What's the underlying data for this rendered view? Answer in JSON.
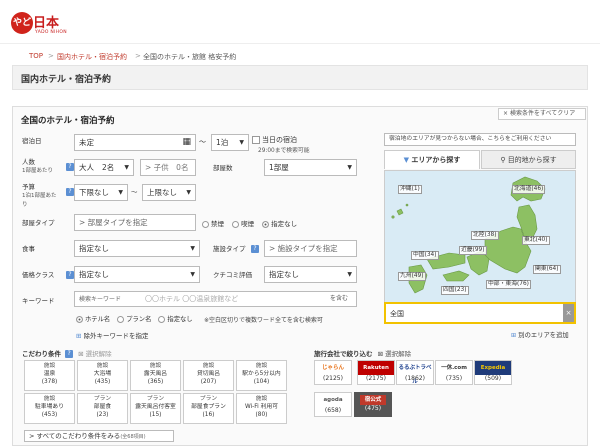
{
  "brand": {
    "logo_mark": "やど",
    "name": "日本",
    "sub": "YADO NIHON",
    "color": "#d0231b"
  },
  "breadcrumb": [
    "TOP",
    "国内ホテル・宿泊予約",
    "全国のホテル・旅館 格安予約"
  ],
  "page_title": "国内ホテル・宿泊予約",
  "clear_all": "検索条件をすべてクリア",
  "search": {
    "title": "全国のホテル・宿泊予約",
    "checkin_label": "宿泊日",
    "checkin_value": "未定",
    "nights_value": "1泊",
    "sameday_label": "当日の宿泊",
    "sameday_note": "29:00まで検索可能",
    "people_label": "人数",
    "people_sub": "1部屋あたり",
    "adults_label": "大人",
    "adults_value": "2名",
    "children_value": "子供　0名",
    "rooms_label": "部屋数",
    "rooms_value": "1部屋",
    "budget_label": "予算",
    "budget_sub1": "1泊1部屋あた",
    "budget_sub2": "り",
    "budget_min": "下限なし",
    "budget_max": "上限なし",
    "roomtype_label": "部屋タイプ",
    "roomtype_placeholder": "部屋タイプを指定",
    "smoke_options": [
      "禁煙",
      "喫煙",
      "指定なし"
    ],
    "meal_label": "食事",
    "meal_value": "指定なし",
    "facility_label": "施設タイプ",
    "facility_placeholder": "施設タイプを指定",
    "price_label": "価格クラス",
    "price_value": "指定なし",
    "review_label": "クチコミ評価",
    "review_value": "指定なし",
    "keyword_label": "キーワード",
    "keyword_hint": "検索キーワード",
    "keyword_placeholder": "〇〇ホテル 〇〇温泉旅館など",
    "keyword_mode": "を含む",
    "keyword_targets": [
      "ホテル名",
      "プラン名",
      "指定なし"
    ],
    "keyword_note": "※空白区切りで複数ワード全てを含む検索可",
    "exclude_keyword": "除外キーワードを指定"
  },
  "conditions": {
    "label": "こだわり条件",
    "reset": "選択解除",
    "items": [
      {
        "cat": "施設",
        "name": "温泉",
        "count": "(378)"
      },
      {
        "cat": "施設",
        "name": "大浴場",
        "count": "(435)"
      },
      {
        "cat": "施設",
        "name": "露天風呂",
        "count": "(365)"
      },
      {
        "cat": "施設",
        "name": "貸切風呂",
        "count": "(207)"
      },
      {
        "cat": "施設",
        "name": "駅から5分以内",
        "count": "(104)"
      },
      {
        "cat": "施設",
        "name": "駐車場あり",
        "count": "(453)"
      },
      {
        "cat": "プラン",
        "name": "部屋食",
        "count": "(23)"
      },
      {
        "cat": "プラン",
        "name": "露天風呂付客室",
        "count": "(15)"
      },
      {
        "cat": "プラン",
        "name": "部屋食プラン",
        "count": "(16)"
      },
      {
        "cat": "施設",
        "name": "Wi-Fi 利用可",
        "count": "(80)"
      }
    ],
    "more": "すべてのこだわり条件をみる",
    "more_count": "(全68項目)"
  },
  "agents": {
    "label": "旅行会社で絞り込む",
    "reset": "選択解除",
    "items": [
      {
        "logo": "じゃらん",
        "count": "(2125)",
        "color": "#e8731a"
      },
      {
        "logo": "Rakuten Travel",
        "count": "(2175)",
        "color": "#ffffff"
      },
      {
        "logo": "るるぶトラベル",
        "count": "(1862)",
        "color": "#1a3e8c"
      },
      {
        "logo": "一休.com",
        "count": "(735)",
        "color": "#333333"
      },
      {
        "logo": "Expedia",
        "count": "(509)",
        "color": "#f6c700"
      },
      {
        "logo": "agoda",
        "count": "(658)",
        "color": "#555555"
      },
      {
        "logo": "宿公式",
        "count": "(475)",
        "color": "#ffffff"
      }
    ]
  },
  "area": {
    "notice": "宿泊地のエリアが見つからない場合、こちらをご利用ください",
    "tab_area": "エリアから探す",
    "tab_dest": "目的地から探す",
    "regions": [
      {
        "name": "沖縄",
        "count": "(1)"
      },
      {
        "name": "北海道",
        "count": "(46)"
      },
      {
        "name": "北陸",
        "count": "(38)"
      },
      {
        "name": "東北",
        "count": "(40)"
      },
      {
        "name": "近畿",
        "count": "(99)"
      },
      {
        "name": "中国",
        "count": "(34)"
      },
      {
        "name": "九州",
        "count": "(49)"
      },
      {
        "name": "関東",
        "count": "(64)"
      },
      {
        "name": "四国",
        "count": "(23)"
      },
      {
        "name": "中部・東海",
        "count": "(76)"
      }
    ],
    "selected": "全国",
    "add_other": "別のエリアを追加"
  }
}
